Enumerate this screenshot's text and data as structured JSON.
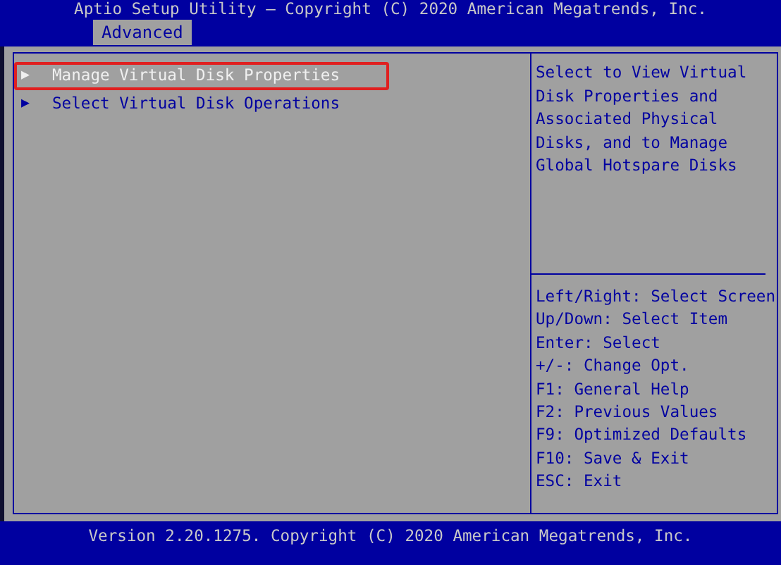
{
  "header": {
    "title": "Aptio Setup Utility – Copyright (C) 2020 American Megatrends, Inc.",
    "tabs": [
      {
        "label": "Advanced",
        "selected": true
      }
    ]
  },
  "menu": {
    "items": [
      {
        "arrow": "▶",
        "label": "Manage Virtual Disk Properties",
        "selected": true,
        "highlighted": true
      },
      {
        "arrow": "▶",
        "label": "Select Virtual Disk Operations",
        "selected": false,
        "highlighted": false
      }
    ]
  },
  "help": {
    "description": "Select to View Virtual Disk Properties and Associated Physical Disks, and to Manage Global Hotspare Disks",
    "keys": [
      "Left/Right: Select Screen",
      "Up/Down: Select Item",
      "Enter: Select",
      "+/-: Change Opt.",
      "F1: General Help",
      "F2: Previous Values",
      "F9: Optimized Defaults",
      "F10: Save & Exit",
      "ESC: Exit"
    ]
  },
  "footer": {
    "text": "Version 2.20.1275. Copyright (C) 2020 American Megatrends, Inc."
  }
}
